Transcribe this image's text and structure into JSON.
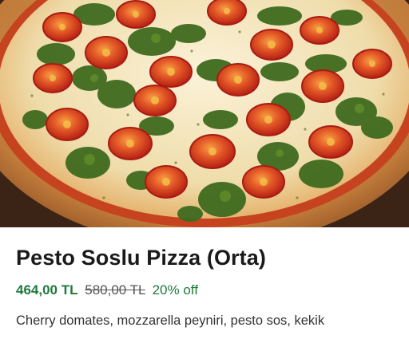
{
  "product": {
    "image_alt": "",
    "name": "Pesto Soslu Pizza (Orta)",
    "price": "464,00 TL",
    "old_price": "580,00 TL",
    "discount": "20% off",
    "description": "Cherry domates, mozzarella peyniri, pesto sos, kekik"
  },
  "colors": {
    "price_green": "#1f7a3a",
    "title_text": "#1a1a1a",
    "crust": "#c98a4a",
    "cheese": "#f3e6c2",
    "tomato": "#d7341f",
    "pesto": "#3f6b1f"
  }
}
